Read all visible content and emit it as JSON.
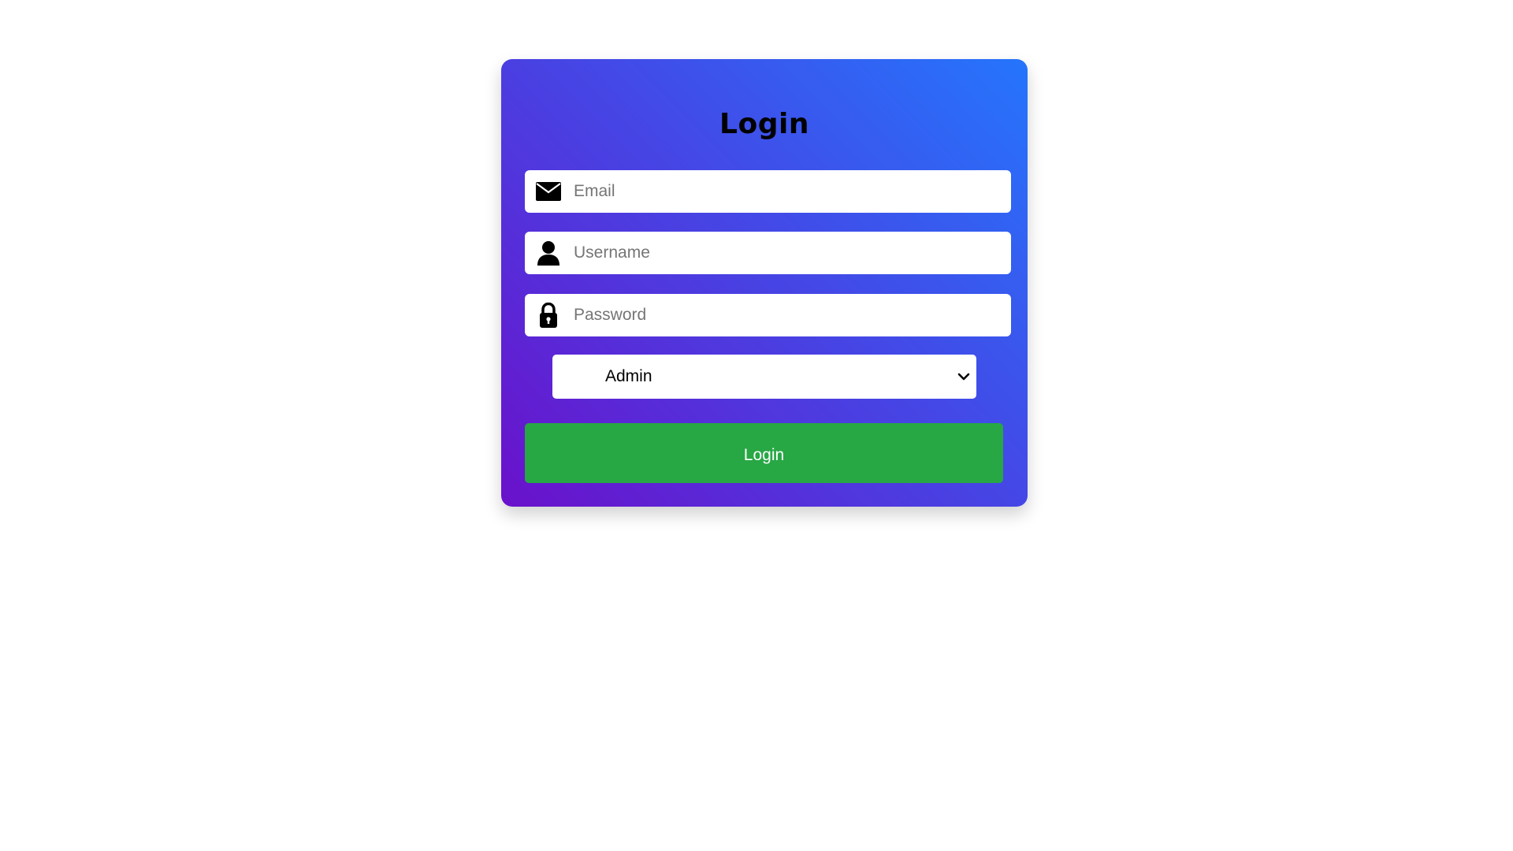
{
  "form": {
    "title": "Login",
    "email": {
      "placeholder": "Email",
      "value": "",
      "icon": "envelope-icon"
    },
    "username": {
      "placeholder": "Username",
      "value": "",
      "icon": "user-icon"
    },
    "password": {
      "placeholder": "Password",
      "value": "",
      "icon": "lock-icon"
    },
    "role": {
      "selected": "Admin",
      "icon": "chevron-down-icon"
    },
    "submit_label": "Login"
  },
  "colors": {
    "gradient_start": "#6a11cb",
    "gradient_end": "#2575fc",
    "button_bg": "#28a745",
    "button_text": "#ffffff"
  }
}
